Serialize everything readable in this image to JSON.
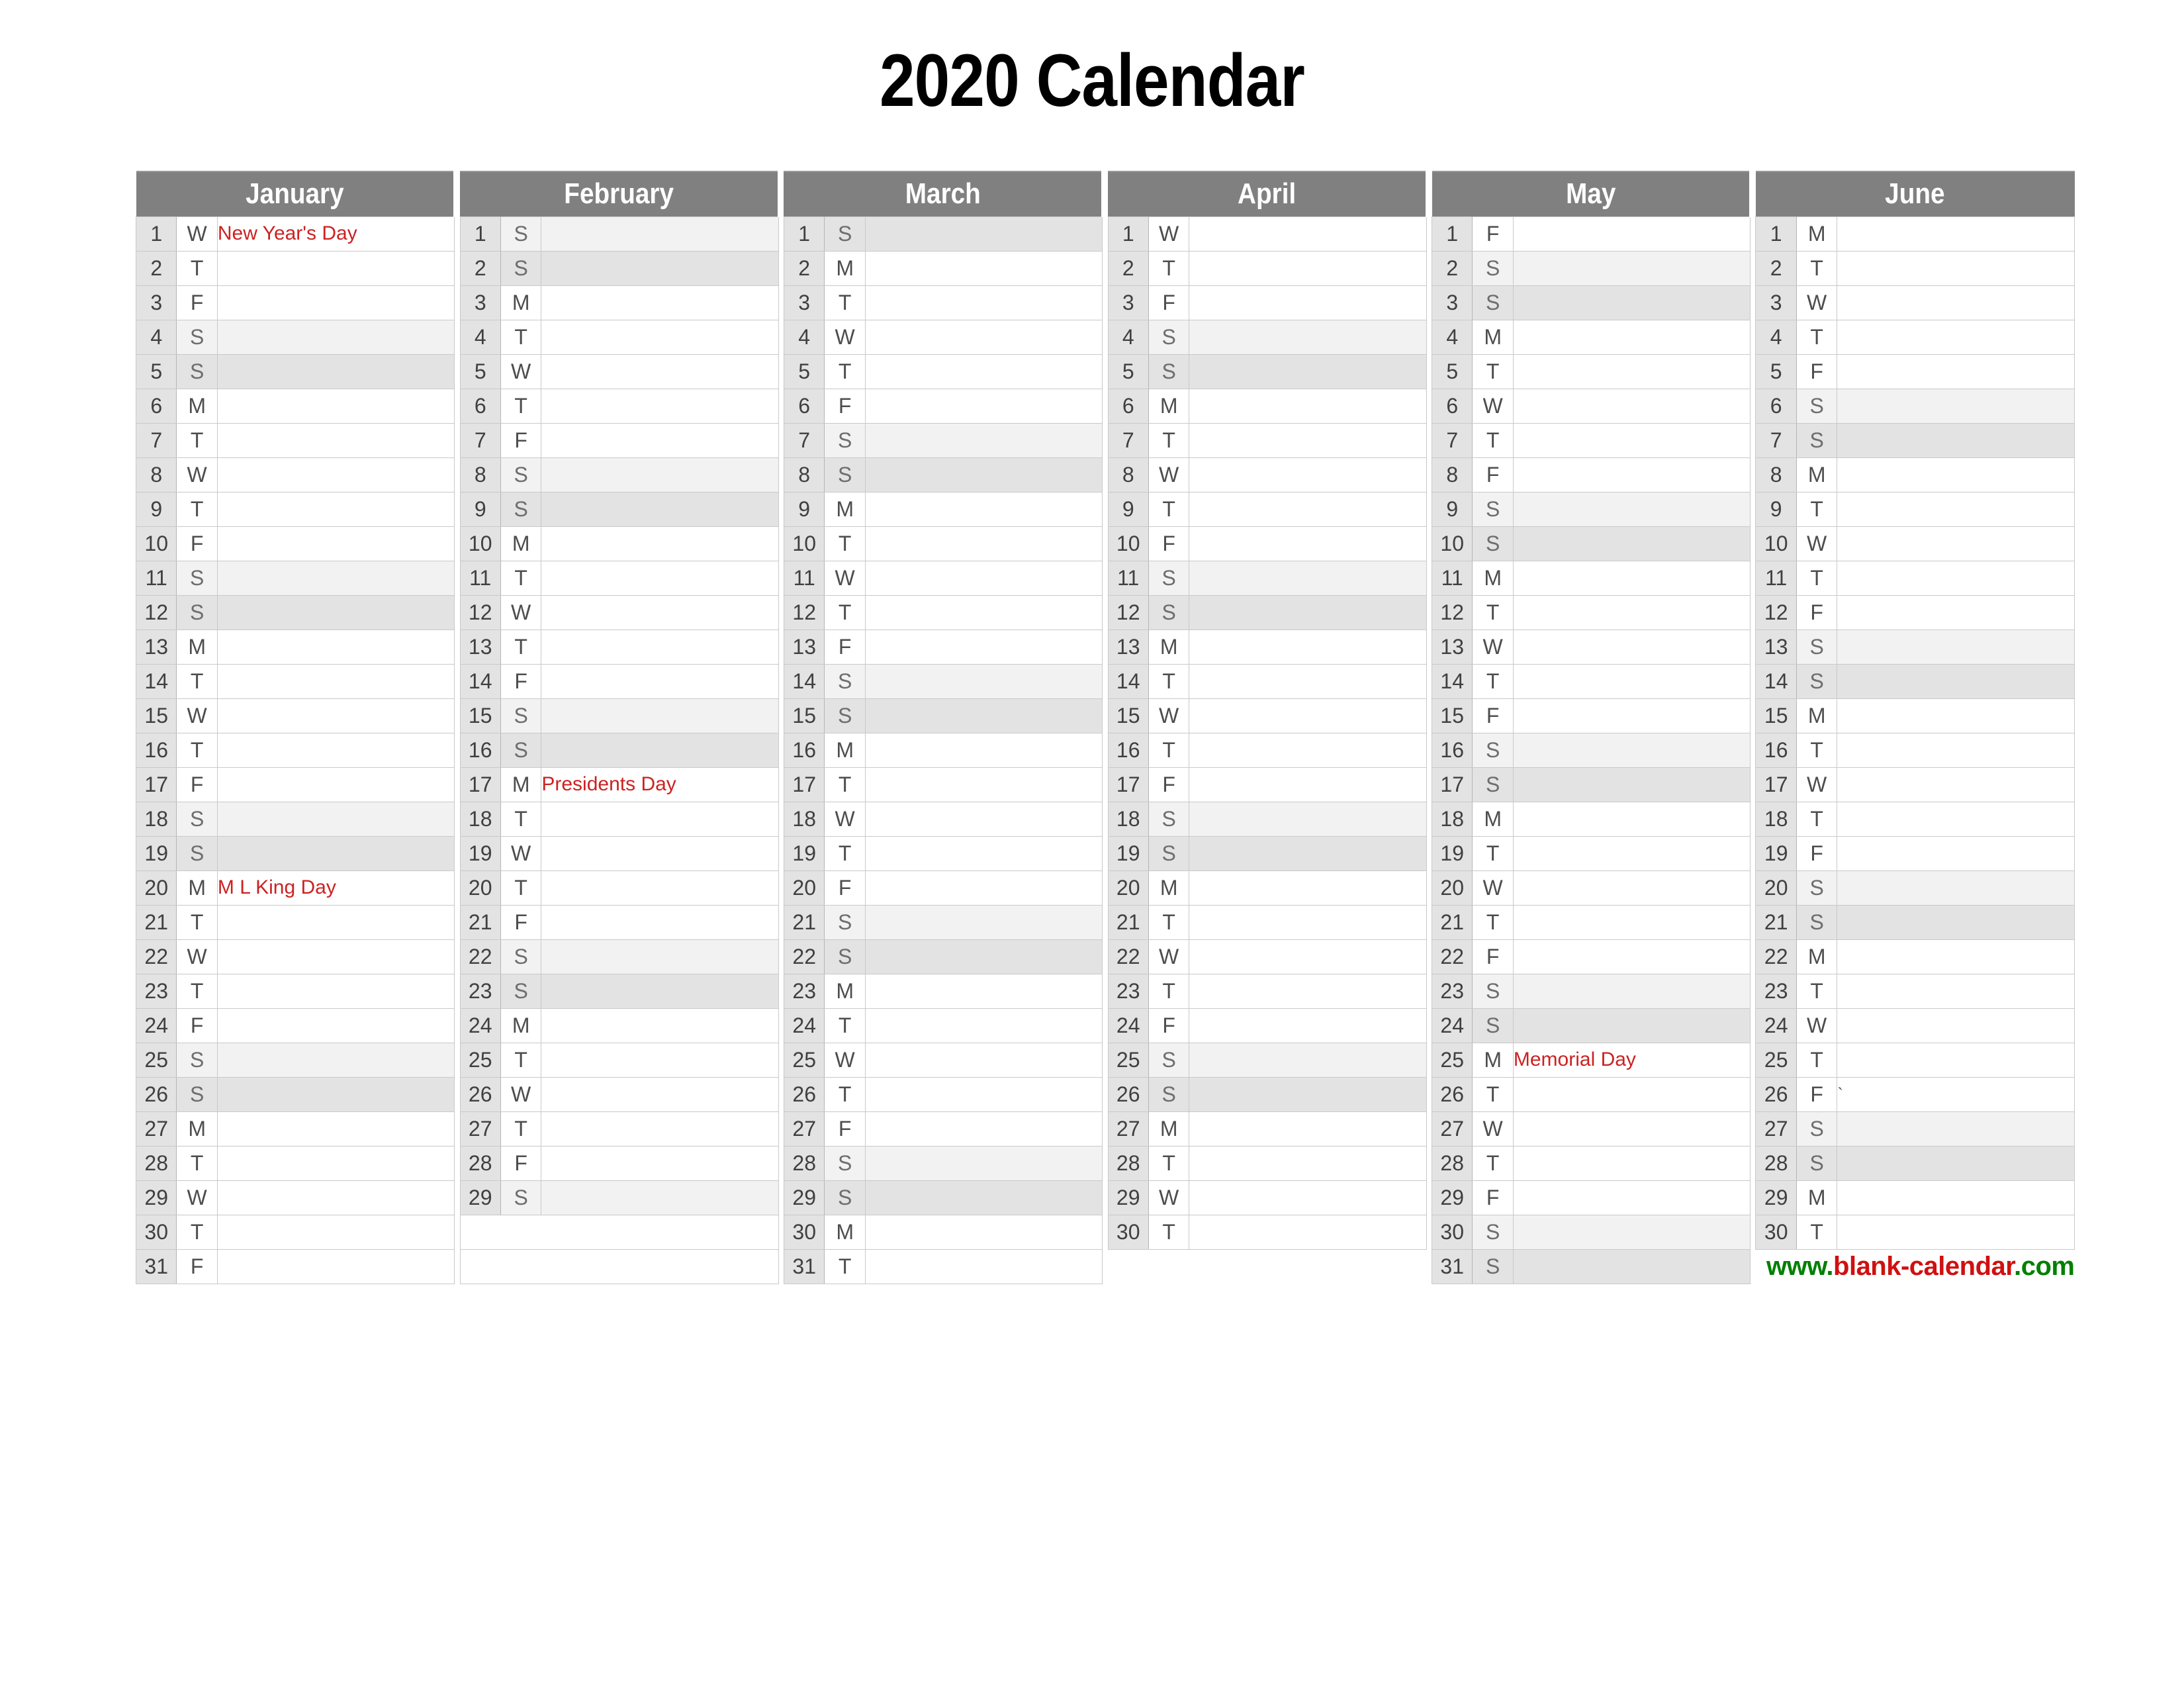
{
  "page": {
    "title": "2020 Calendar",
    "year": 2020
  },
  "footer": {
    "url_full": "www.blank-calendar.com",
    "url_part_1": "www.",
    "url_part_2": "blank-calendar",
    "url_part_3": ".com",
    "color_green": "#008000",
    "color_red": "#d01010"
  },
  "colors": {
    "header_band": "#808080",
    "header_text": "#ffffff",
    "daynum_bg": "#e3e3e3",
    "saturday_bg": "#f2f2f2",
    "sunday_bg": "#e3e3e3",
    "holiday_text": "#cc2222",
    "grid_line": "#c9c9c9",
    "body_text": "#4d4d4d"
  },
  "calendar": {
    "row_count": 31,
    "months": [
      {
        "name": "January",
        "index": 1,
        "days_in_month": 31,
        "first_weekday_letter": "W",
        "weekdays": [
          "W",
          "T",
          "F",
          "S",
          "S",
          "M",
          "T",
          "W",
          "T",
          "F",
          "S",
          "S",
          "M",
          "T",
          "W",
          "T",
          "F",
          "S",
          "S",
          "M",
          "T",
          "W",
          "T",
          "F",
          "S",
          "S",
          "M",
          "T",
          "W",
          "T",
          "F"
        ],
        "weekend_kind": [
          "",
          "",
          "",
          "sat",
          "sun",
          "",
          "",
          "",
          "",
          "",
          "sat",
          "sun",
          "",
          "",
          "",
          "",
          "",
          "sat",
          "sun",
          "",
          "",
          "",
          "",
          "",
          "sat",
          "sun",
          "",
          "",
          "",
          "",
          ""
        ],
        "notes": [
          "New Year's Day",
          "",
          "",
          "",
          "",
          "",
          "",
          "",
          "",
          "",
          "",
          "",
          "",
          "",
          "",
          "",
          "",
          "",
          "",
          "M L King Day",
          "",
          "",
          "",
          "",
          "",
          "",
          "",
          "",
          "",
          "",
          ""
        ]
      },
      {
        "name": "February",
        "index": 2,
        "days_in_month": 29,
        "first_weekday_letter": "S",
        "weekdays": [
          "S",
          "S",
          "M",
          "T",
          "W",
          "T",
          "F",
          "S",
          "S",
          "M",
          "T",
          "W",
          "T",
          "F",
          "S",
          "S",
          "M",
          "T",
          "W",
          "T",
          "F",
          "S",
          "S",
          "M",
          "T",
          "W",
          "T",
          "F",
          "S"
        ],
        "weekend_kind": [
          "sat",
          "sun",
          "",
          "",
          "",
          "",
          "",
          "sat",
          "sun",
          "",
          "",
          "",
          "",
          "",
          "sat",
          "sun",
          "",
          "",
          "",
          "",
          "",
          "sat",
          "sun",
          "",
          "",
          "",
          "",
          "",
          "sat"
        ],
        "notes": [
          "",
          "",
          "",
          "",
          "",
          "",
          "",
          "",
          "",
          "",
          "",
          "",
          "",
          "",
          "",
          "",
          "Presidents Day",
          "",
          "",
          "",
          "",
          "",
          "",
          "",
          "",
          "",
          "",
          "",
          ""
        ]
      },
      {
        "name": "March",
        "index": 3,
        "days_in_month": 31,
        "first_weekday_letter": "S",
        "weekdays": [
          "S",
          "M",
          "T",
          "W",
          "T",
          "F",
          "S",
          "S",
          "M",
          "T",
          "W",
          "T",
          "F",
          "S",
          "S",
          "M",
          "T",
          "W",
          "T",
          "F",
          "S",
          "S",
          "M",
          "T",
          "W",
          "T",
          "F",
          "S",
          "S",
          "M",
          "T"
        ],
        "weekend_kind": [
          "sun",
          "",
          "",
          "",
          "",
          "",
          "sat",
          "sun",
          "",
          "",
          "",
          "",
          "",
          "sat",
          "sun",
          "",
          "",
          "",
          "",
          "",
          "sat",
          "sun",
          "",
          "",
          "",
          "",
          "",
          "sat",
          "sun",
          "",
          ""
        ],
        "notes": [
          "",
          "",
          "",
          "",
          "",
          "",
          "",
          "",
          "",
          "",
          "",
          "",
          "",
          "",
          "",
          "",
          "",
          "",
          "",
          "",
          "",
          "",
          "",
          "",
          "",
          "",
          "",
          "",
          "",
          "",
          ""
        ]
      },
      {
        "name": "April",
        "index": 4,
        "days_in_month": 30,
        "first_weekday_letter": "W",
        "weekdays": [
          "W",
          "T",
          "F",
          "S",
          "S",
          "M",
          "T",
          "W",
          "T",
          "F",
          "S",
          "S",
          "M",
          "T",
          "W",
          "T",
          "F",
          "S",
          "S",
          "M",
          "T",
          "W",
          "T",
          "F",
          "S",
          "S",
          "M",
          "T",
          "W",
          "T"
        ],
        "weekend_kind": [
          "",
          "",
          "",
          "sat",
          "sun",
          "",
          "",
          "",
          "",
          "",
          "sat",
          "sun",
          "",
          "",
          "",
          "",
          "",
          "sat",
          "sun",
          "",
          "",
          "",
          "",
          "",
          "sat",
          "sun",
          "",
          "",
          "",
          ""
        ],
        "notes": [
          "",
          "",
          "",
          "",
          "",
          "",
          "",
          "",
          "",
          "",
          "",
          "",
          "",
          "",
          "",
          "",
          "",
          "",
          "",
          "",
          "",
          "",
          "",
          "",
          "",
          "",
          "",
          "",
          "",
          ""
        ]
      },
      {
        "name": "May",
        "index": 5,
        "days_in_month": 31,
        "first_weekday_letter": "F",
        "weekdays": [
          "F",
          "S",
          "S",
          "M",
          "T",
          "W",
          "T",
          "F",
          "S",
          "S",
          "M",
          "T",
          "W",
          "T",
          "F",
          "S",
          "S",
          "M",
          "T",
          "W",
          "T",
          "F",
          "S",
          "S",
          "M",
          "T",
          "W",
          "T",
          "F",
          "S",
          "S"
        ],
        "weekend_kind": [
          "",
          "sat",
          "sun",
          "",
          "",
          "",
          "",
          "",
          "sat",
          "sun",
          "",
          "",
          "",
          "",
          "",
          "sat",
          "sun",
          "",
          "",
          "",
          "",
          "",
          "sat",
          "sun",
          "",
          "",
          "",
          "",
          "",
          "sat",
          "sun"
        ],
        "notes": [
          "",
          "",
          "",
          "",
          "",
          "",
          "",
          "",
          "",
          "",
          "",
          "",
          "",
          "",
          "",
          "",
          "",
          "",
          "",
          "",
          "",
          "",
          "",
          "",
          "Memorial Day",
          "",
          "",
          "",
          "",
          "",
          ""
        ]
      },
      {
        "name": "June",
        "index": 6,
        "days_in_month": 30,
        "first_weekday_letter": "M",
        "weekdays": [
          "M",
          "T",
          "W",
          "T",
          "F",
          "S",
          "S",
          "M",
          "T",
          "W",
          "T",
          "F",
          "S",
          "S",
          "M",
          "T",
          "W",
          "T",
          "F",
          "S",
          "S",
          "M",
          "T",
          "W",
          "T",
          "F",
          "S",
          "S",
          "M",
          "T"
        ],
        "weekend_kind": [
          "",
          "",
          "",
          "",
          "",
          "sat",
          "sun",
          "",
          "",
          "",
          "",
          "",
          "sat",
          "sun",
          "",
          "",
          "",
          "",
          "",
          "sat",
          "sun",
          "",
          "",
          "",
          "",
          "",
          "sat",
          "sun",
          "",
          ""
        ],
        "notes": [
          "",
          "",
          "",
          "",
          "",
          "",
          "",
          "",
          "",
          "",
          "",
          "",
          "",
          "",
          "",
          "",
          "",
          "",
          "",
          "",
          "",
          "",
          "",
          "",
          "",
          "`",
          "",
          "",
          "",
          ""
        ]
      }
    ]
  }
}
